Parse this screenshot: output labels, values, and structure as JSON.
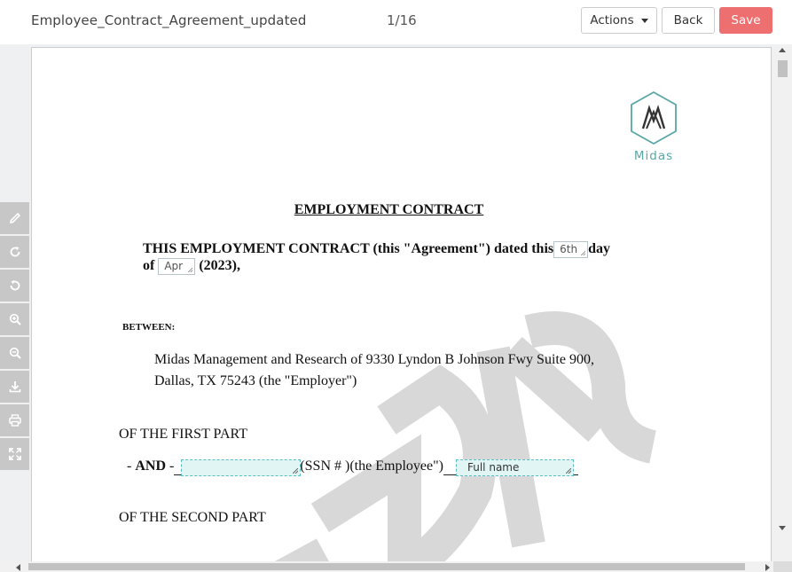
{
  "header": {
    "doc_title": "Employee_Contract_Agreement_updated",
    "page_counter": "1/16",
    "actions_label": "Actions",
    "back_label": "Back",
    "save_label": "Save",
    "save_color": "#ee6f6f"
  },
  "toolbar": {
    "tools": [
      {
        "name": "edit",
        "icon": "pencil-icon"
      },
      {
        "name": "rotate-clockwise",
        "icon": "rotate-cw-icon"
      },
      {
        "name": "rotate-counterclockwise",
        "icon": "rotate-ccw-icon"
      },
      {
        "name": "zoom-in",
        "icon": "zoom-in-icon"
      },
      {
        "name": "zoom-out",
        "icon": "zoom-out-icon"
      },
      {
        "name": "download",
        "icon": "download-icon"
      },
      {
        "name": "print",
        "icon": "printer-icon"
      },
      {
        "name": "fullscreen",
        "icon": "expand-icon"
      }
    ]
  },
  "document": {
    "logo_text": "Midas",
    "logo_color": "#5aa6a6",
    "watermark_text": "MIDAS",
    "title": "EMPLOYMENT CONTRACT",
    "intro_part1": "THIS EMPLOYMENT CONTRACT (this \"Agreement\") dated this",
    "day_value": "6th",
    "intro_part2": "day",
    "of_label": "of",
    "month_value": "Apr",
    "year_text": "(2023),",
    "between_label": "BETWEEN:",
    "employer_line1": "Midas Management and Research of 9330 Lyndon B Johnson Fwy Suite 900,",
    "employer_line2": "Dallas, TX 75243 (the \"Employer\")",
    "first_part": "OF THE FIRST PART",
    "and_label": "AND",
    "ssn_text": "(SSN # )",
    "employee_text": "(the Employee\")",
    "full_name_placeholder": "Full name",
    "second_part": "OF THE SECOND PART",
    "field_accent": "#57bfc4"
  }
}
